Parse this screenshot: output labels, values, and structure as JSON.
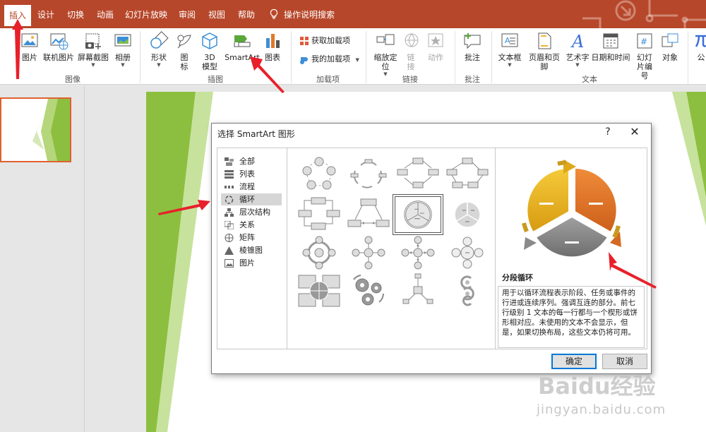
{
  "tabs": [
    "插入",
    "设计",
    "切换",
    "动画",
    "幻灯片放映",
    "审阅",
    "视图",
    "帮助"
  ],
  "tell_me": "操作说明搜索",
  "ribbon": {
    "images": {
      "picture": "图片",
      "online_picture": "联机图片",
      "screenshot": "屏幕截图",
      "album": "相册",
      "group": "图像"
    },
    "illustrations": {
      "shapes": "形状",
      "icons": "图标",
      "models_3d": "3D\n模型",
      "smartart": "SmartArt",
      "chart": "图表",
      "group": "插图"
    },
    "addins": {
      "get": "获取加载项",
      "mine": "我的加载项",
      "group": "加载项"
    },
    "links": {
      "zoom": "缩放定位",
      "link": "链接",
      "action": "动作",
      "group": "链接"
    },
    "comments": {
      "comment": "批注",
      "group": "批注"
    },
    "text": {
      "textbox": "文本框",
      "header_footer": "页眉和页脚",
      "wordart": "艺术字",
      "datetime": "日期和时间",
      "slide_number": "幻灯片编号",
      "object": "对象",
      "group": "文本"
    },
    "symbols": {
      "equation": "公"
    }
  },
  "dialog": {
    "title": "选择 SmartArt 图形",
    "help": "?",
    "close": "✕",
    "categories": [
      "全部",
      "列表",
      "流程",
      "循环",
      "层次结构",
      "关系",
      "矩阵",
      "棱锥图",
      "图片"
    ],
    "selected_category": "循环",
    "preview_name": "分段循环",
    "preview_desc": "用于以循环流程表示阶段、任务或事件的行进或连续序列。强调互连的部分。前七行级别 1 文本的每一行都与一个楔形或饼形相对应。未使用的文本不会显示，但是，如果切换布局，这些文本仍将可用。",
    "ok": "确定",
    "cancel": "取消"
  },
  "watermark": {
    "logo": "Baidu经验",
    "url": "jingyan.baidu.com"
  },
  "colors": {
    "accent": "#b7472a",
    "slide_green": "#8cbf3f",
    "segment_yellow": "#e8b21a",
    "segment_orange": "#e07a28",
    "segment_gray": "#8c8c8c",
    "arrow_red": "#e8202a"
  }
}
